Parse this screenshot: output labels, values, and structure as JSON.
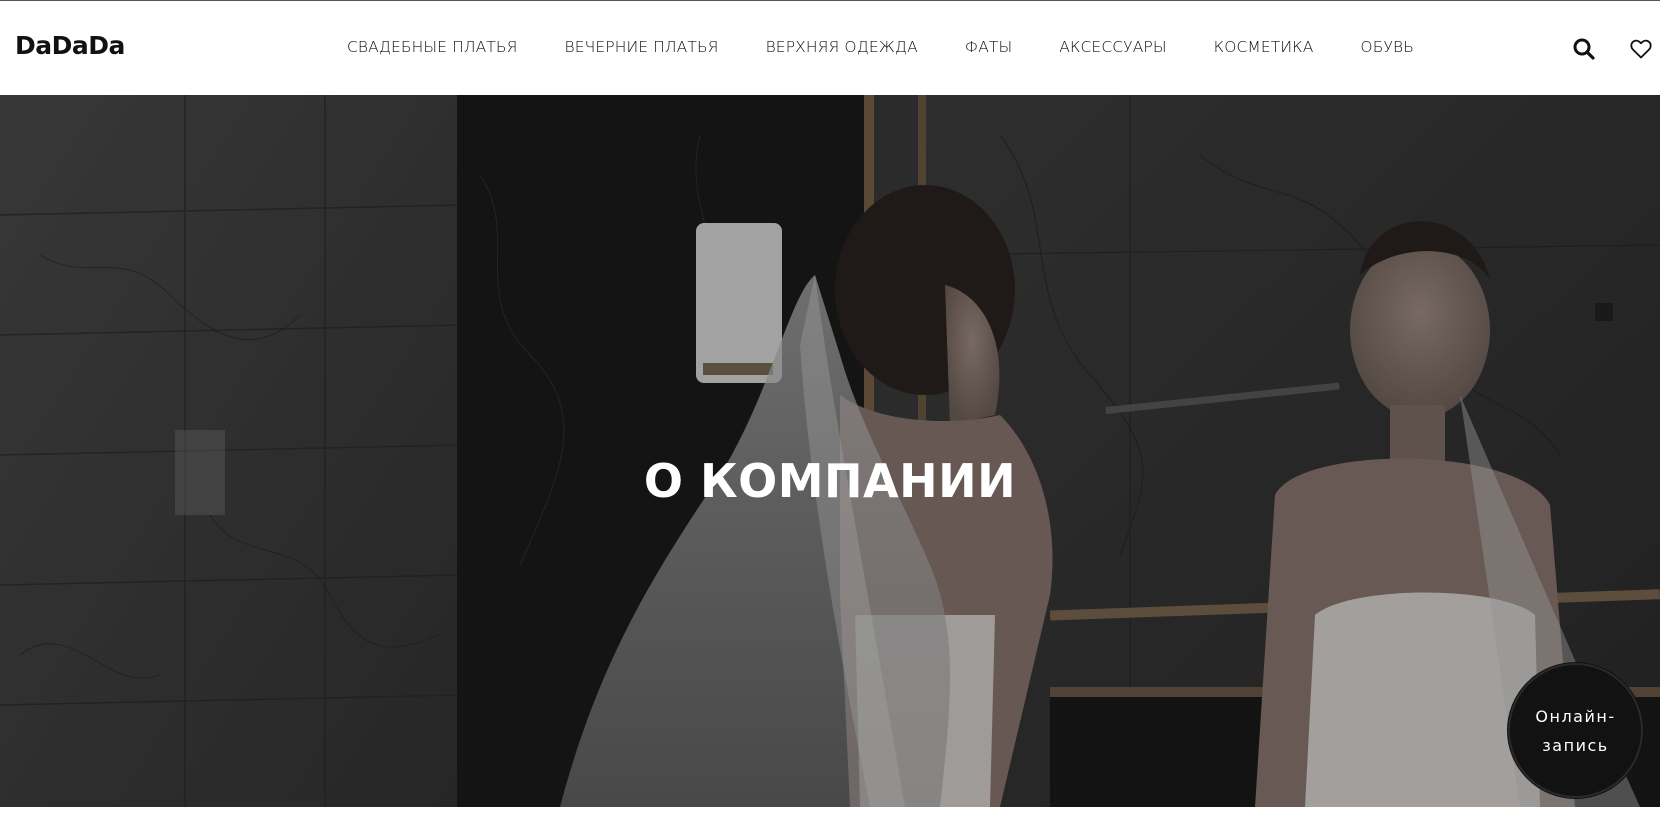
{
  "header": {
    "logo": "DaDaDa",
    "nav": [
      {
        "label": "СВАДЕБНЫЕ ПЛАТЬЯ"
      },
      {
        "label": "ВЕЧЕРНИЕ ПЛАТЬЯ"
      },
      {
        "label": "ВЕРХНЯЯ ОДЕЖДА"
      },
      {
        "label": "ФАТЫ"
      },
      {
        "label": "АКСЕССУАРЫ"
      },
      {
        "label": "КОСМЕТИКА"
      },
      {
        "label": "ОБУВЬ"
      }
    ],
    "icons": [
      "search-icon",
      "heart-icon"
    ]
  },
  "hero": {
    "title": "О КОМПАНИИ"
  },
  "booking": {
    "label": "Онлайн-запись"
  },
  "colors": {
    "text": "#111111",
    "hero_overlay": "#2b2b2b",
    "booking_bg": "#121212",
    "white": "#ffffff"
  }
}
